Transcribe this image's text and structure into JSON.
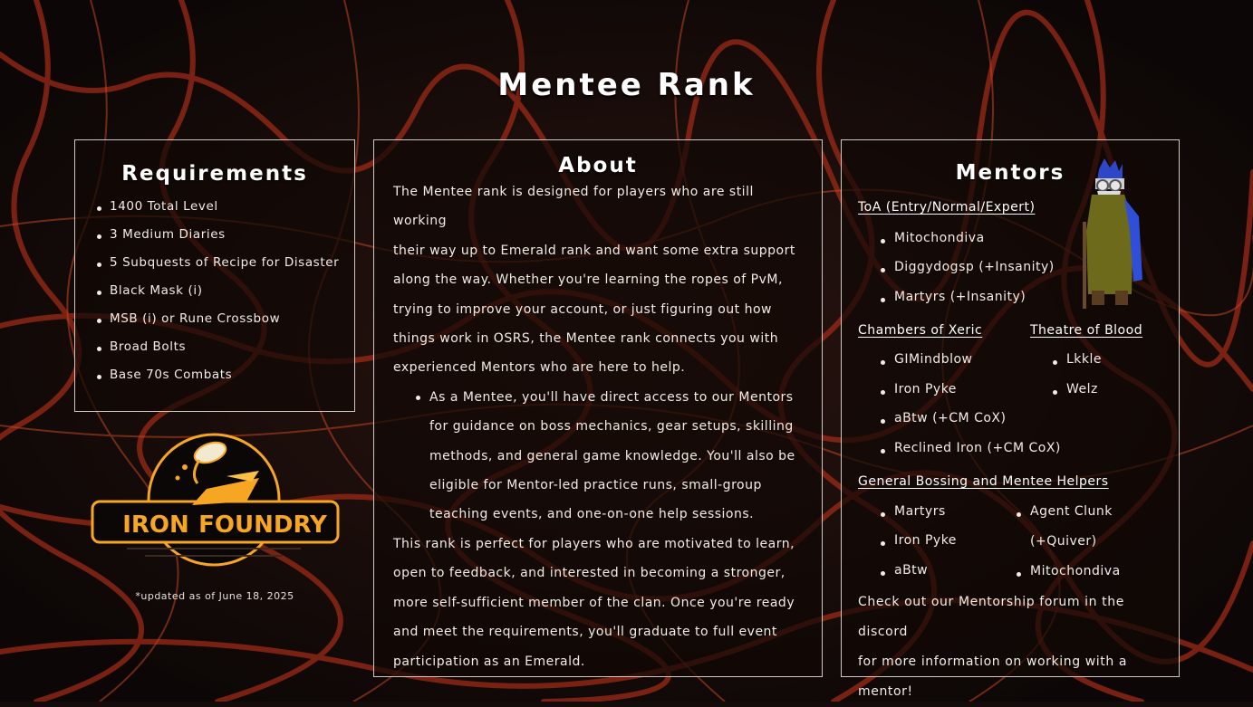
{
  "page_title": "Mentee Rank",
  "requirements": {
    "title": "Requirements",
    "items": [
      "1400 Total Level",
      "3 Medium Diaries",
      "5 Subquests of Recipe for Disaster",
      "Black Mask (i)",
      "MSB (i) or Rune Crossbow",
      "Broad Bolts",
      "Base 70s Combats"
    ]
  },
  "about": {
    "title": "About",
    "lines_intro": [
      "The Mentee rank is designed for players who are still working",
      "their way up to Emerald rank and want some extra support",
      "along the way. Whether you're learning the ropes of PvM,",
      "trying to improve your account, or just figuring out how",
      "things work in OSRS, the Mentee rank connects you with",
      "experienced Mentors who are here to help."
    ],
    "bullet_lines": [
      "As a Mentee, you'll have direct access to our Mentors",
      "for guidance on boss mechanics, gear setups, skilling",
      "methods, and general game knowledge. You'll also be",
      "eligible for Mentor-led practice runs, small-group",
      "teaching events, and one-on-one help sessions."
    ],
    "lines_outro": [
      "This rank is perfect for players who are motivated to learn,",
      "open to feedback, and interested in becoming a stronger,",
      "more self-sufficient member of the clan. Once you're ready",
      "and meet the requirements, you'll graduate to full event",
      "participation as an Emerald."
    ]
  },
  "mentors": {
    "title": "Mentors",
    "toa": {
      "heading": "ToA (Entry/Normal/Expert)",
      "names": [
        "Mitochondiva",
        "Diggydogsp (+Insanity)",
        "Martyrs (+Insanity)"
      ]
    },
    "cox": {
      "heading": "Chambers of Xeric",
      "names": [
        "GIMindblow",
        "Iron Pyke",
        "aBtw (+CM CoX)",
        "Reclined Iron (+CM CoX)"
      ]
    },
    "tob": {
      "heading": "Theatre of Blood",
      "names": [
        "Lkkle",
        "Welz"
      ]
    },
    "general": {
      "heading": "General Bossing and Mentee Helpers",
      "left_names": [
        "Martyrs",
        "Iron Pyke",
        "aBtw"
      ],
      "right_names": [
        "Agent Clunk",
        "(+Quiver)",
        "Mitochondiva"
      ]
    },
    "footer_lines": [
      "Check out our Mentorship forum in the discord",
      "for more information on working with a mentor!"
    ]
  },
  "logo": {
    "word1": "IRON",
    "word2": "FOUNDRY"
  },
  "updated_note": "*updated as of June 18, 2025",
  "colors": {
    "background": "#140c0a",
    "lava": "#a8301a",
    "logo_orange": "#f6a623",
    "text": "#f2ece6"
  },
  "icons": [
    "wizard-avatar-icon",
    "iron-foundry-logo-icon"
  ]
}
